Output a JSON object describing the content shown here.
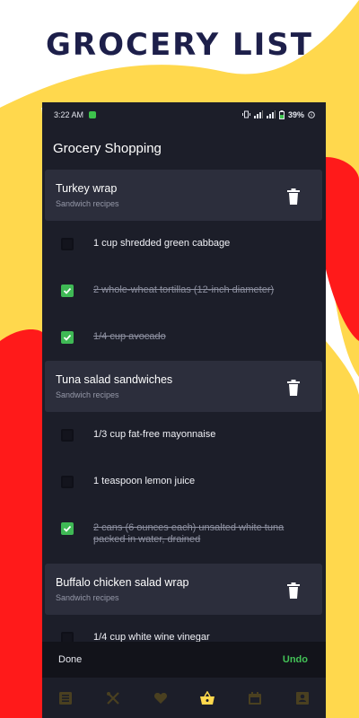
{
  "promo": {
    "title": "GROCERY LIST"
  },
  "status_bar": {
    "time": "3:22 AM",
    "battery": "39%"
  },
  "app_bar": {
    "title": "Grocery Shopping"
  },
  "recipes": [
    {
      "title": "Turkey wrap",
      "subtitle": "Sandwich recipes",
      "items": [
        {
          "text": "1 cup shredded green cabbage",
          "checked": false
        },
        {
          "text": "2 whole-wheat tortillas (12-inch diameter)",
          "checked": true
        },
        {
          "text": "1/4 cup avocado",
          "checked": true
        }
      ]
    },
    {
      "title": "Tuna salad sandwiches",
      "subtitle": "Sandwich recipes",
      "items": [
        {
          "text": "1/3 cup fat-free mayonnaise",
          "checked": false
        },
        {
          "text": "1 teaspoon lemon juice",
          "checked": false
        },
        {
          "text": "2 cans (6 ounces each) unsalted white tuna packed in water, drained",
          "checked": true
        }
      ]
    },
    {
      "title": "Buffalo chicken salad wrap",
      "subtitle": "Sandwich recipes",
      "items": [
        {
          "text": "1/4 cup white wine vinegar",
          "checked": false
        }
      ]
    }
  ],
  "snackbar": {
    "message": "Done",
    "action": "Undo"
  },
  "bottom_nav": [
    {
      "icon": "list-icon",
      "active": false
    },
    {
      "icon": "utensils-icon",
      "active": false
    },
    {
      "icon": "heart-icon",
      "active": false
    },
    {
      "icon": "shopping-basket-icon",
      "active": true
    },
    {
      "icon": "calendar-icon",
      "active": false
    },
    {
      "icon": "profile-card-icon",
      "active": false
    }
  ],
  "colors": {
    "accent_yellow": "#ffd84d",
    "accent_red": "#ff1a1a",
    "check_green": "#3fb955",
    "surface": "#1c1e29",
    "header_surface": "#2c2e3c"
  }
}
